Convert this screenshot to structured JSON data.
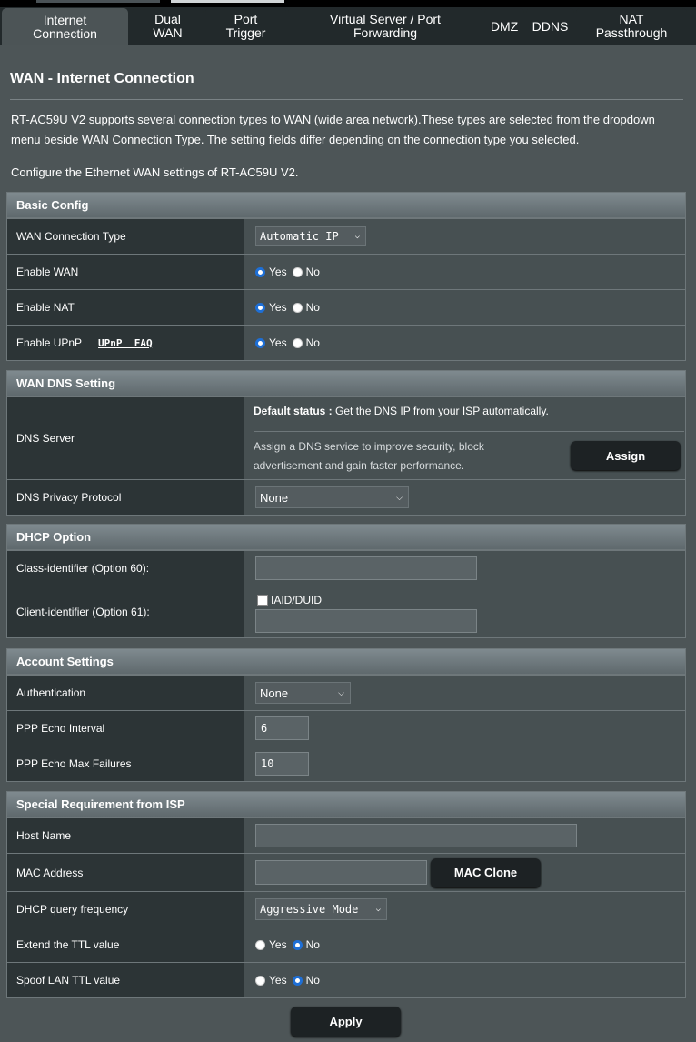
{
  "tabs": [
    {
      "label": "Internet\nConnection"
    },
    {
      "label": "Dual\nWAN"
    },
    {
      "label": "Port\nTrigger"
    },
    {
      "label": "Virtual Server / Port\nForwarding"
    },
    {
      "label": "DMZ"
    },
    {
      "label": "DDNS"
    },
    {
      "label": "NAT\nPassthrough"
    }
  ],
  "page": {
    "title": "WAN - Internet Connection",
    "desc1": "RT-AC59U V2 supports several connection types to WAN (wide area network).These types are selected from the dropdown menu beside WAN Connection Type. The setting fields differ depending on the connection type you selected.",
    "desc2": "Configure the Ethernet WAN settings of RT-AC59U V2."
  },
  "radio": {
    "yes": "Yes",
    "no": "No"
  },
  "basic": {
    "header": "Basic Config",
    "wan_type_label": "WAN Connection Type",
    "wan_type_value": "Automatic IP",
    "enable_wan_label": "Enable WAN",
    "enable_wan": "yes",
    "enable_nat_label": "Enable NAT",
    "enable_nat": "yes",
    "enable_upnp_label": "Enable UPnP",
    "upnp_faq": "UPnP  FAQ",
    "enable_upnp": "yes"
  },
  "dns": {
    "header": "WAN DNS Setting",
    "server_label": "DNS Server",
    "default_status_label": "Default status :",
    "default_status_text": " Get the DNS IP from your ISP automatically.",
    "assign_text": "Assign a DNS service to improve security, block advertisement and gain faster performance.",
    "assign_button": "Assign",
    "privacy_label": "DNS Privacy Protocol",
    "privacy_value": "None"
  },
  "dhcp": {
    "header": "DHCP Option",
    "class_label": "Class-identifier (Option 60):",
    "class_value": "",
    "client_label": "Client-identifier (Option 61):",
    "iaid_label": "IAID/DUID",
    "client_value": ""
  },
  "account": {
    "header": "Account Settings",
    "auth_label": "Authentication",
    "auth_value": "None",
    "echo_interval_label": "PPP Echo Interval",
    "echo_interval_value": "6",
    "echo_max_label": "PPP Echo Max Failures",
    "echo_max_value": "10"
  },
  "isp": {
    "header": "Special Requirement from ISP",
    "host_label": "Host Name",
    "host_value": "",
    "mac_label": "MAC Address",
    "mac_value": "",
    "mac_clone_button": "MAC Clone",
    "dhcp_freq_label": "DHCP query frequency",
    "dhcp_freq_value": "Aggressive Mode",
    "ttl_label": "Extend the TTL value",
    "ttl": "no",
    "spoof_label": "Spoof LAN TTL value",
    "spoof": "no"
  },
  "apply_button": "Apply"
}
